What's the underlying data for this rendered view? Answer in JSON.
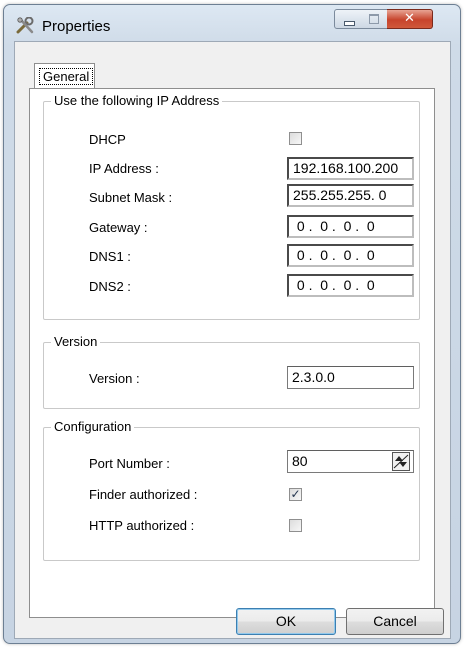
{
  "window": {
    "title": "Properties",
    "icon": "tools-icon"
  },
  "title_controls": {
    "minimize": "minimize-icon",
    "maximize": "maximize-icon",
    "close": "close-icon",
    "close_glyph": "✕"
  },
  "tabs": [
    {
      "label": "General",
      "selected": true
    }
  ],
  "ip_group": {
    "title": "Use the following IP Address",
    "dhcp_label": "DHCP",
    "dhcp_checked": false,
    "ip_label": "IP Address :",
    "ip_value": "192.168.100.200",
    "subnet_label": "Subnet Mask :",
    "subnet_value": "255.255.255. 0",
    "gateway_label": "Gateway :",
    "gateway_value": " 0 .  0 .  0 .  0",
    "dns1_label": "DNS1 :",
    "dns1_value": " 0 .  0 .  0 .  0",
    "dns2_label": "DNS2 :",
    "dns2_value": " 0 .  0 .  0 .  0"
  },
  "version_group": {
    "title": "Version",
    "version_label": "Version :",
    "version_value": "2.3.0.0"
  },
  "config_group": {
    "title": "Configuration",
    "port_label": "Port Number :",
    "port_value": "80",
    "finder_label": "Finder authorized :",
    "finder_checked": true,
    "http_label": "HTTP authorized :",
    "http_checked": false,
    "check_glyph": "✓"
  },
  "buttons": {
    "ok": "OK",
    "cancel": "Cancel"
  },
  "colors": {
    "window_frame": "#cfdbe8",
    "close_button": "#c7442c",
    "panel": "#ffffff",
    "dialog_bg": "#f0f0f0"
  }
}
